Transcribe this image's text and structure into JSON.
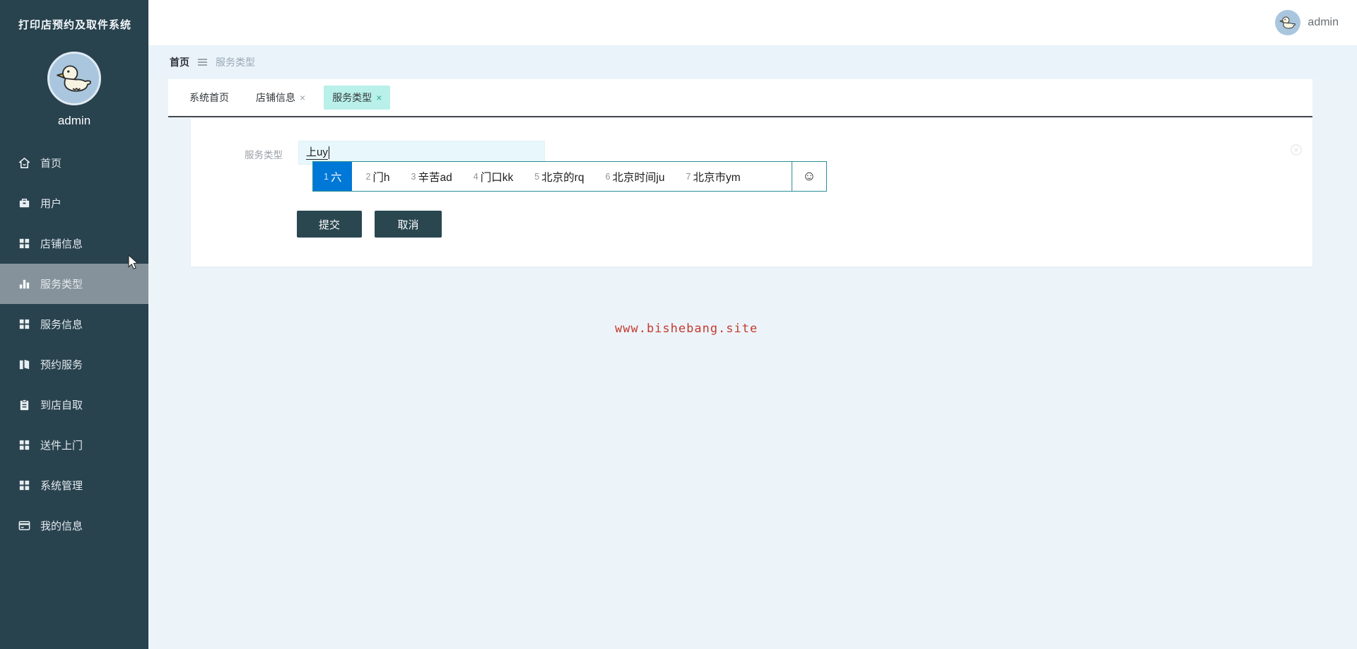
{
  "app": {
    "title": "打印店预约及取件系统",
    "username": "admin"
  },
  "topbar": {
    "username": "admin"
  },
  "sidebar": {
    "items": [
      {
        "label": "首页",
        "icon": "home-icon",
        "active": false
      },
      {
        "label": "用户",
        "icon": "briefcase-icon",
        "active": false
      },
      {
        "label": "店铺信息",
        "icon": "grid-icon",
        "active": false
      },
      {
        "label": "服务类型",
        "icon": "bar-chart-icon",
        "active": true
      },
      {
        "label": "服务信息",
        "icon": "grid-icon",
        "active": false
      },
      {
        "label": "预约服务",
        "icon": "book-icon",
        "active": false
      },
      {
        "label": "到店自取",
        "icon": "clipboard-icon",
        "active": false
      },
      {
        "label": "送件上门",
        "icon": "grid-icon",
        "active": false
      },
      {
        "label": "系统管理",
        "icon": "grid-icon",
        "active": false
      },
      {
        "label": "我的信息",
        "icon": "card-icon",
        "active": false
      }
    ]
  },
  "breadcrumb": {
    "home": "首页",
    "current": "服务类型"
  },
  "tabs": [
    {
      "label": "系统首页",
      "closable": false,
      "active": false
    },
    {
      "label": "店铺信息",
      "closable": true,
      "active": false
    },
    {
      "label": "服务类型",
      "closable": true,
      "active": true
    }
  ],
  "ui": {
    "close_glyph": "×"
  },
  "form": {
    "label": "服务类型",
    "input_value": "上uy",
    "submit_label": "提交",
    "cancel_label": "取消"
  },
  "ime": {
    "candidates": [
      {
        "index": "1",
        "text": "六",
        "selected": true
      },
      {
        "index": "2",
        "text": "门h",
        "selected": false
      },
      {
        "index": "3",
        "text": "辛苦ad",
        "selected": false
      },
      {
        "index": "4",
        "text": "门口kk",
        "selected": false
      },
      {
        "index": "5",
        "text": "北京的rq",
        "selected": false
      },
      {
        "index": "6",
        "text": "北京时间ju",
        "selected": false
      },
      {
        "index": "7",
        "text": "北京市ym",
        "selected": false
      }
    ],
    "emoji": "☺"
  },
  "watermark": {
    "text": "www.bishebang.site"
  },
  "colors": {
    "sidebar_bg": "#28424e",
    "sidebar_active_bg": "#86929b",
    "band_bg": "#eaf3fa",
    "content_bg": "#edf4f9",
    "tab_active_bg": "#b9f0ea",
    "ime_selected_bg": "#0078d7",
    "ime_border": "#2b8e96",
    "button_bg": "#2a4750",
    "input_bg": "#e8f7fb",
    "watermark_red": "#c43a2f",
    "avatar_bg": "#a9c6de"
  }
}
